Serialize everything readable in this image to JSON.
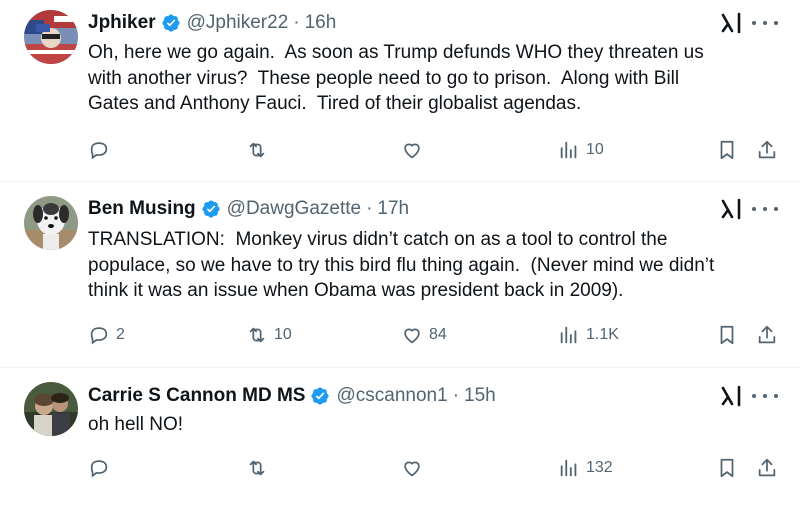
{
  "tweets": [
    {
      "name": "Jphiker",
      "handle": "@Jphiker22",
      "sep": "·",
      "time": "16h",
      "text": "Oh, here we go again.  As soon as Trump defunds WHO they threaten us\nwith another virus?  These people need to go to prison.  Along with Bill\nGates and Anthony Fauci.  Tired of their globalist agendas.",
      "replies": "",
      "retweets": "",
      "likes": "",
      "views": "10"
    },
    {
      "name": "Ben Musing",
      "handle": "@DawgGazette",
      "sep": "·",
      "time": "17h",
      "text": "TRANSLATION:  Monkey virus didn’t catch on as a tool to control the\npopulace, so we have to try this bird flu thing again.  (Never mind we didn’t\nthink it was an issue when Obama was president back in 2009).",
      "replies": "2",
      "retweets": "10",
      "likes": "84",
      "views": "1.1K"
    },
    {
      "name": "Carrie S Cannon MD MS",
      "handle": "@cscannon1",
      "sep": "·",
      "time": "15h",
      "text": "oh hell NO!",
      "replies": "",
      "retweets": "",
      "likes": "",
      "views": "132"
    }
  ],
  "icons": {
    "verified": "verified-badge-icon",
    "grok": "grok-icon",
    "more": "more-options-icon",
    "reply": "reply-icon",
    "retweet": "retweet-icon",
    "like": "like-icon",
    "views": "views-icon",
    "bookmark": "bookmark-icon",
    "share": "share-icon"
  },
  "colors": {
    "verified": "#1d9bf0",
    "secondary": "#536471",
    "divider": "#eff3f4"
  }
}
